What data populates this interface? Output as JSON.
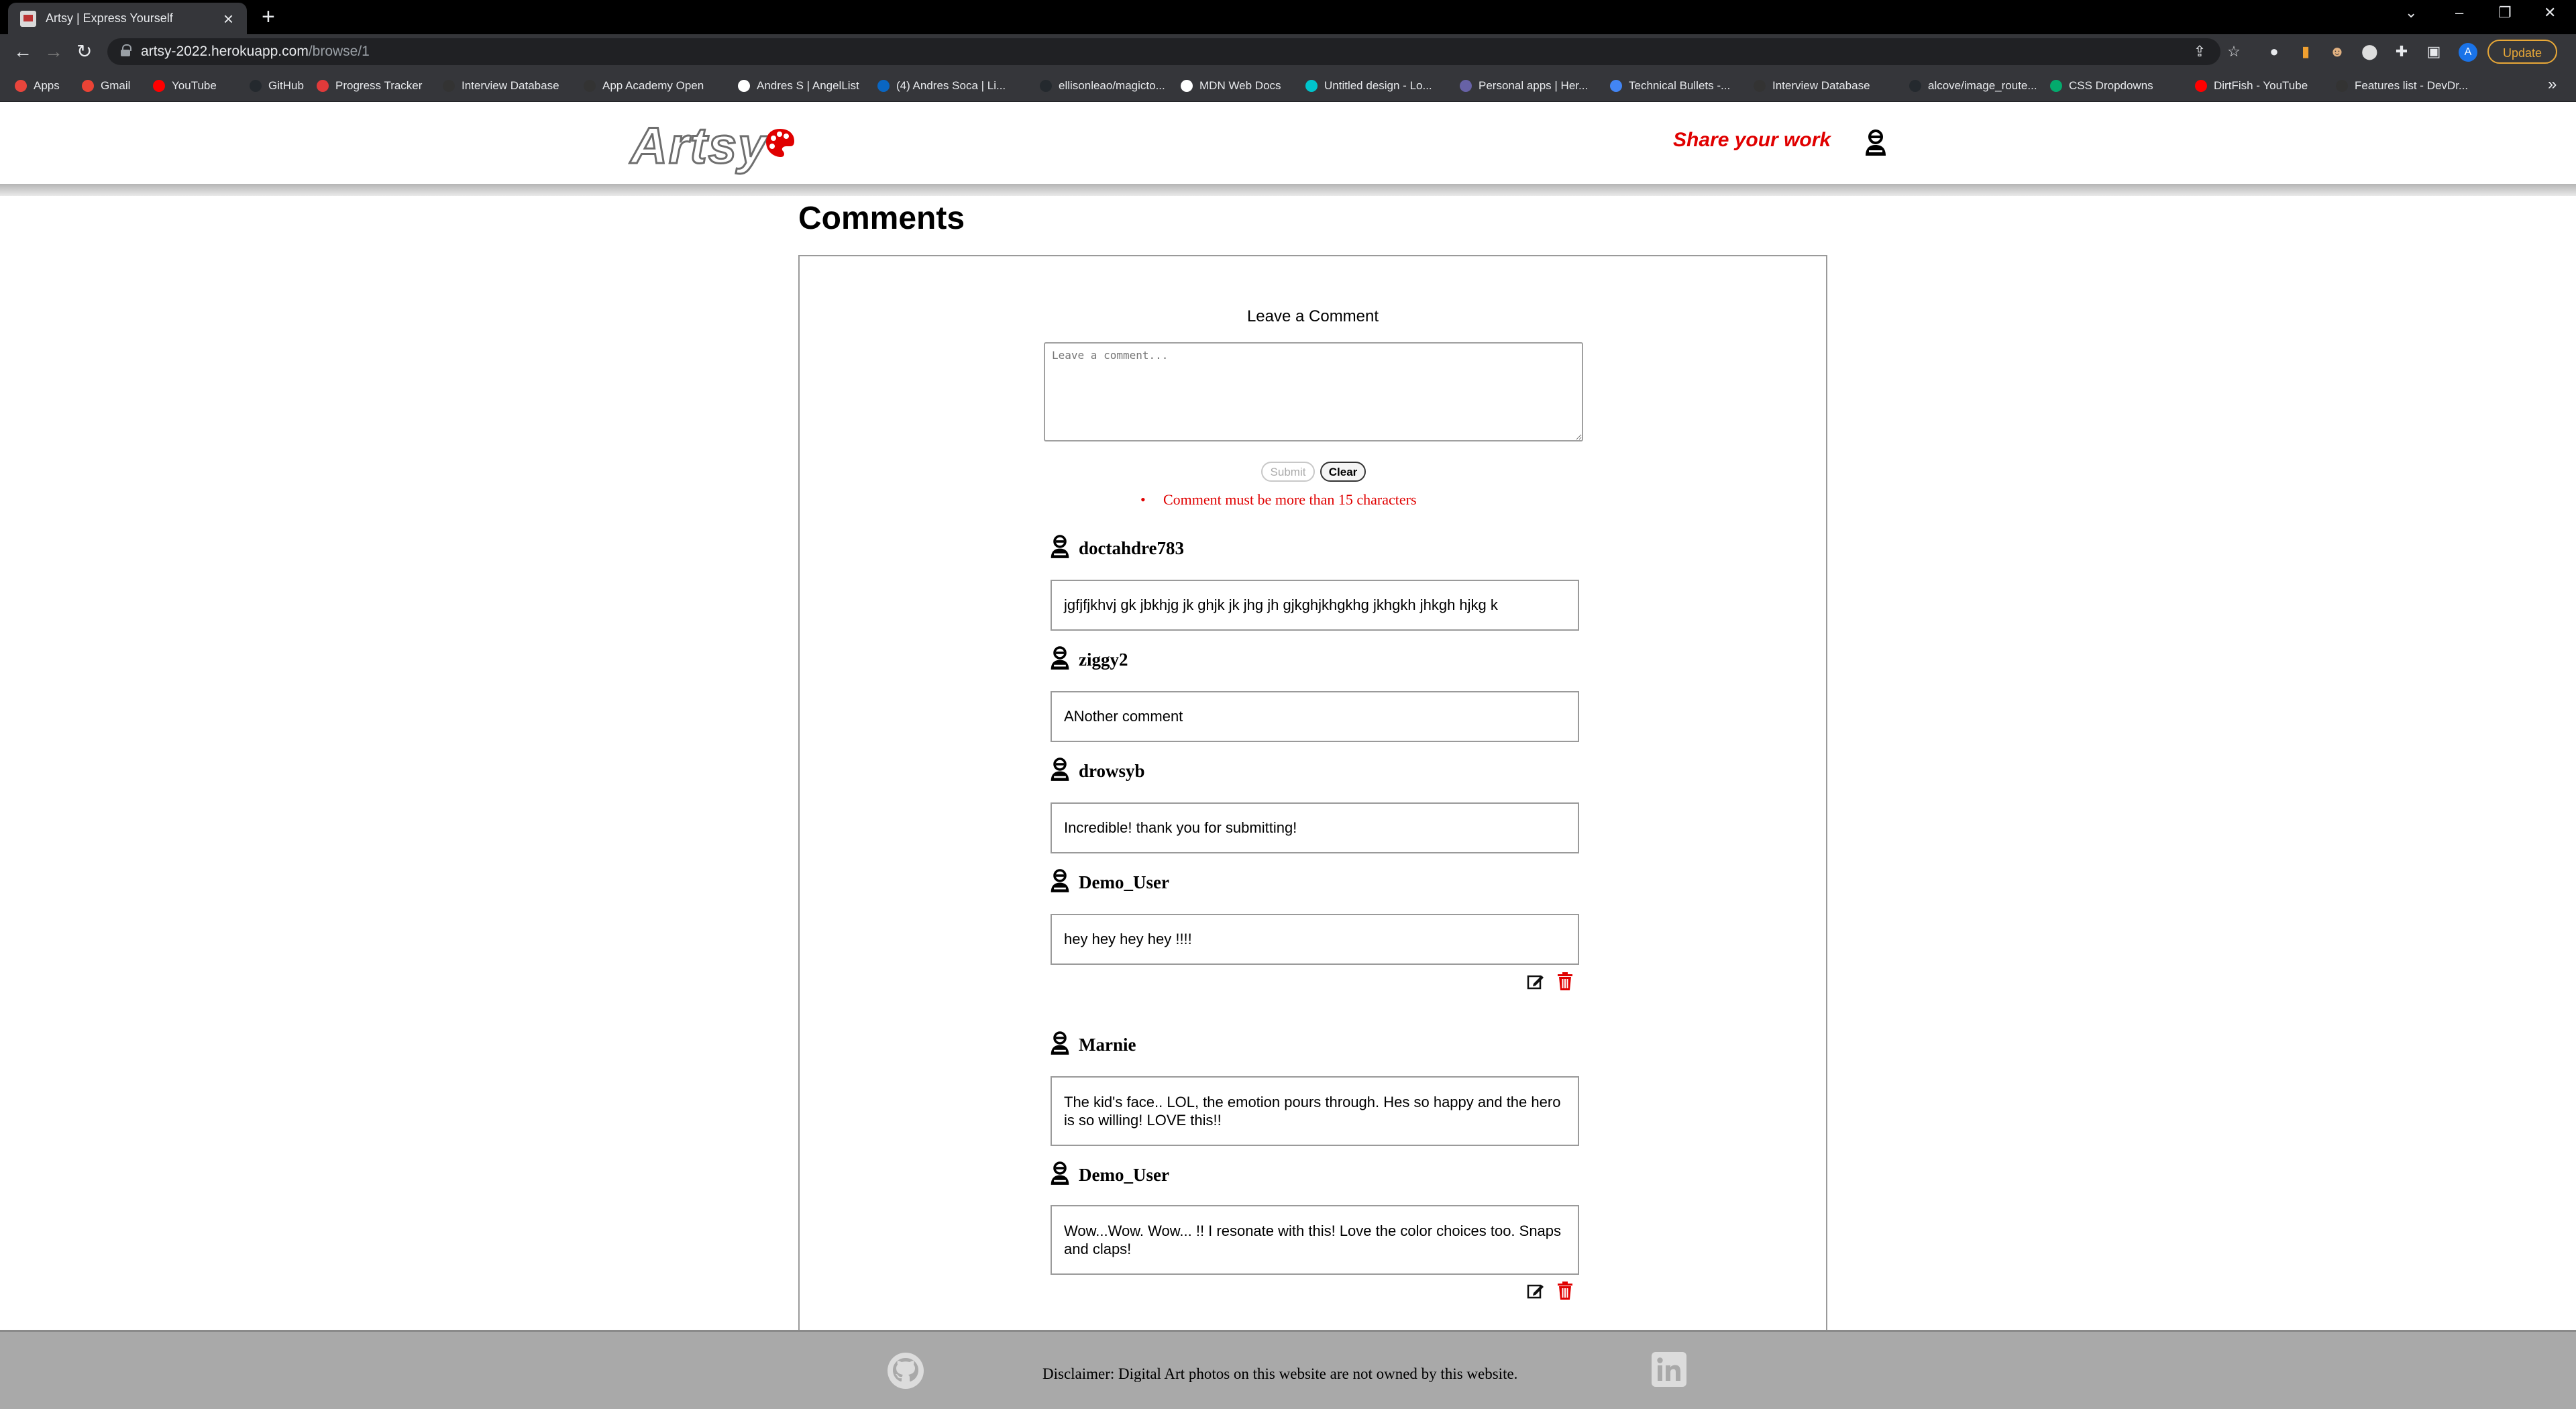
{
  "browser": {
    "tab_title": "Artsy | Express Yourself",
    "url_host": "artsy-2022.herokuapp.com",
    "url_path": "/browse/1",
    "update_label": "Update",
    "profile_letter": "A",
    "bookmarks": [
      {
        "label": "Apps",
        "color": "#e8453c"
      },
      {
        "label": "Gmail",
        "color": "#ea4335"
      },
      {
        "label": "YouTube",
        "color": "#ff0000"
      },
      {
        "label": "GitHub",
        "color": "#24292e"
      },
      {
        "label": "Progress Tracker",
        "color": "#e03a3a"
      },
      {
        "label": "Interview Database",
        "color": "#333333"
      },
      {
        "label": "App Academy Open",
        "color": "#333333"
      },
      {
        "label": "Andres S | AngelList",
        "color": "#ffffff"
      },
      {
        "label": "(4) Andres Soca | Li...",
        "color": "#0a66c2"
      },
      {
        "label": "ellisonleao/magicto...",
        "color": "#24292e"
      },
      {
        "label": "MDN Web Docs",
        "color": "#ffffff"
      },
      {
        "label": "Untitled design - Lo...",
        "color": "#00c4cc"
      },
      {
        "label": "Personal apps | Her...",
        "color": "#6762a6"
      },
      {
        "label": "Technical Bullets -...",
        "color": "#4285f4"
      },
      {
        "label": "Interview Database",
        "color": "#333333"
      },
      {
        "label": "alcove/image_route...",
        "color": "#24292e"
      },
      {
        "label": "CSS Dropdowns",
        "color": "#04aa6d"
      },
      {
        "label": "DirtFish - YouTube",
        "color": "#ff0000"
      },
      {
        "label": "Features list - DevDr...",
        "color": "#333333"
      }
    ]
  },
  "header": {
    "logo_text": "Artsy",
    "share_label": "Share your work"
  },
  "main": {
    "title": "Comments",
    "leave_label": "Leave a Comment",
    "textarea_placeholder": "Leave a comment...",
    "submit_label": "Submit",
    "clear_label": "Clear",
    "error": "Comment must be more than 15 characters",
    "comments": [
      {
        "user": "doctahdre783",
        "text": "jgfjfjkhvj gk jbkhjg jk ghjk jk jhg jh gjkghjkhgkhg jkhgkh jhkgh hjkg k",
        "owner": false
      },
      {
        "user": "ziggy2",
        "text": "ANother comment",
        "owner": false
      },
      {
        "user": "drowsyb",
        "text": "Incredible! thank you for submitting!",
        "owner": false
      },
      {
        "user": "Demo_User",
        "text": "hey hey hey hey !!!!",
        "owner": true
      },
      {
        "user": "Marnie",
        "text": "The kid's face.. LOL, the emotion pours through. Hes so happy and the hero is so willing! LOVE this!!",
        "owner": false
      },
      {
        "user": "Demo_User",
        "text": "Wow...Wow. Wow... !! I resonate with this! Love the color choices too. Snaps and claps!",
        "owner": true
      }
    ]
  },
  "footer": {
    "disclaimer": "Disclaimer: Digital Art photos on this website are not owned by this website."
  },
  "colors": {
    "accent_red": "#e00000",
    "footer_bg": "#a9a9a9",
    "chrome_dark": "#35363a"
  }
}
